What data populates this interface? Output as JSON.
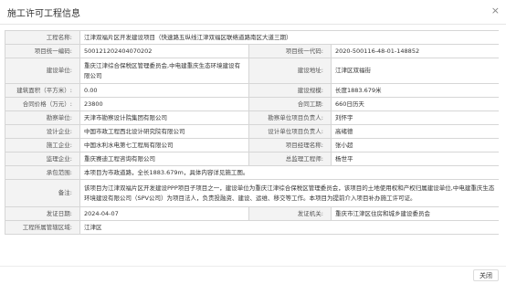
{
  "dialog": {
    "title": "施工许可工程信息",
    "close_icon": "×"
  },
  "fields": {
    "project_name_label": "工程名称:",
    "project_name": "江津双福片区开发建设项目（快速路五纵线江津双福区联络道路南区大道三期）",
    "unified_code_label": "项目统一编码:",
    "unified_code": "500121202404070202",
    "project_code_label": "项目统一代码:",
    "project_code": "2020-500116-48-01-148852",
    "builder_label": "建设单位:",
    "builder": "重庆江津综合保税区管理委员会,中电建重庆生态环境建设有限公司",
    "location_label": "建设地址:",
    "location": "江津区双福街",
    "area_label": "建筑面积（平方米）:",
    "area": "0.00",
    "scale_label": "建设规模:",
    "scale": "长度1883.679米",
    "price_label": "合同价格（万元）:",
    "price": "23800",
    "period_label": "合同工期:",
    "period": "660日历天",
    "survey_label": "勘察单位:",
    "survey": "天津市勘察设计院集团有限公司",
    "survey_lead_label": "勘察单位项目负责人:",
    "survey_lead": "刘怀宇",
    "design_label": "设计企业:",
    "design": "中国市政工程西北设计研究院有限公司",
    "design_lead_label": "设计单位项目负责人:",
    "design_lead": "高绪德",
    "construct_label": "施工企业:",
    "construct": "中国水利水电第七工程局有限公司",
    "pm_label": "项目经理名称:",
    "pm": "张小超",
    "supervise_label": "监理企业:",
    "supervise": "重庆赛迪工程咨询有限公司",
    "chief_label": "总监理工程师:",
    "chief": "杨世平",
    "scope_label": "承包范围:",
    "scope": "本项目为市政道路，全长1883.679m，具体内容详见施工图。",
    "remark_label": "备注:",
    "remark": "该项目为江津双福片区开发建设PPP项目子项目之一，建设单位为重庆江津综合保税区管理委员会，该项目的土地使用权和产权归属建设单位,中电建重庆生态环境建设有限公司（SPV公司）为项目法人，负责投融资、建设、运维、移交等工作。本项目为提前介入项目补办施工许可证。",
    "issue_date_label": "发证日期:",
    "issue_date": "2024-04-07",
    "issuer_label": "发证机关:",
    "issuer": "重庆市江津区住房和城乡建设委员会",
    "district_label": "工程所属管辖区域:",
    "district": "江津区"
  },
  "footer": {
    "close_button": "关闭"
  }
}
